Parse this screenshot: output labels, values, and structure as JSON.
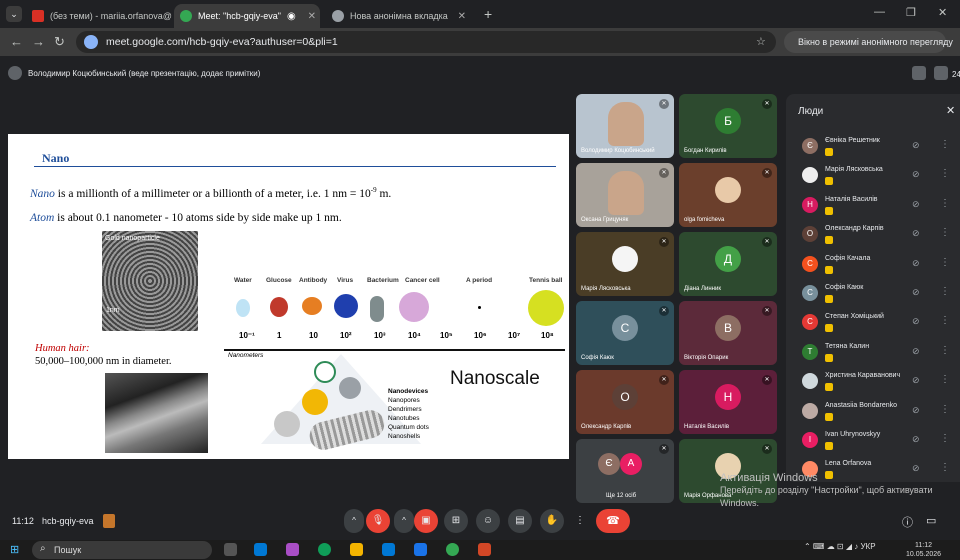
{
  "browser": {
    "tabs": [
      {
        "label": "(без теми) - mariia.orfanova@",
        "favicon_color": "#d93025"
      },
      {
        "label": "Meet: \"hcb-gqiy-eva\"",
        "favicon_color": "#34a853"
      },
      {
        "label": "Нова анонімна вкладка",
        "favicon_color": "#9aa0a6"
      }
    ],
    "url": "meet.google.com/hcb-gqiy-eva?authuser=0&pli=1",
    "incognito_label": "Вікно в режимі анонімного перегляду"
  },
  "meet": {
    "presenter_text": "Володимир Коцюбинський (веде презентацію, додає примітки)",
    "participant_count": "24",
    "time": "11:12",
    "meeting_code": "hcb-gqiy-eva"
  },
  "slide": {
    "title": "Nano",
    "p1_word": "Nano",
    "p1_text": " is a millionth of a millimeter or a billionth of a meter, i.e. 1 nm = 10",
    "p1_exp": "-9",
    "p1_end": " m.",
    "p2_word": "Atom",
    "p2_text": " is  about 0.1 nanometer - 10 atoms side by side make up 1 nm.",
    "gold_label": "Gold nanoparticle",
    "gold_scale": "1nm",
    "hair_label": "Human hair:",
    "hair_text": "50,000–100,000 nm in diameter.",
    "scale_labels": [
      "Water",
      "Glucose",
      "Antibody",
      "Virus",
      "Bacterium",
      "Cancer cell",
      "A period",
      "Tennis ball"
    ],
    "scale_numbers": [
      "10⁻¹",
      "1",
      "10",
      "10²",
      "10³",
      "10⁴",
      "10⁵",
      "10⁶",
      "10⁷",
      "10⁸"
    ],
    "axis_label": "Nanometers",
    "big_label": "Nanoscale",
    "nanodevices_title": "Nanodevices",
    "nanodevices": [
      "Nanopores",
      "Dendrimers",
      "Nanotubes",
      "Quantum dots",
      "Nanoshells"
    ]
  },
  "tiles": [
    {
      "name": "Володимир Коцюбинський",
      "type": "video",
      "bg": "#b8c4cf"
    },
    {
      "name": "Богдан Кирилів",
      "type": "avatar",
      "letter": "Б",
      "bg": "#2d4a2f",
      "av": "#2e7d32"
    },
    {
      "name": "Оксана Грицуняк",
      "type": "video",
      "bg": "#a8a29a"
    },
    {
      "name": "olga fomicheva",
      "type": "avatar",
      "letter": "",
      "bg": "#6b3f2c",
      "av": "#e8c9a8"
    },
    {
      "name": "Марія Лясковська",
      "type": "avatar",
      "letter": "",
      "bg": "#4a3d26",
      "av": "#f5f5f5"
    },
    {
      "name": "Діана Линник",
      "type": "avatar",
      "letter": "Д",
      "bg": "#2d4a2f",
      "av": "#43a047"
    },
    {
      "name": "Софія Каюк",
      "type": "avatar",
      "letter": "С",
      "bg": "#2f4f5a",
      "av": "#78909c"
    },
    {
      "name": "Вікторія Опарик",
      "type": "avatar",
      "letter": "В",
      "bg": "#5c2a3a",
      "av": "#8d6e63"
    },
    {
      "name": "Олександр Карпів",
      "type": "avatar",
      "letter": "О",
      "bg": "#6b3a2c",
      "av": "#5d4037"
    },
    {
      "name": "Наталія Василів",
      "type": "avatar",
      "letter": "Н",
      "bg": "#5c1f3a",
      "av": "#d81b60"
    },
    {
      "name": "Ще 12 осіб",
      "type": "more",
      "letter": "Є",
      "letter2": "А",
      "bg": "#3c4043",
      "av": "#8d6e63",
      "av2": "#e91e63"
    },
    {
      "name": "Марія Орфанова",
      "type": "avatar",
      "letter": "",
      "bg": "#2d4a2f",
      "av": "#e8d2b0"
    }
  ],
  "people": {
    "title": "Люди",
    "list": [
      {
        "name": "Євніка Решетник",
        "letter": "Є",
        "color": "#8d6e63"
      },
      {
        "name": "Марія Лясковська",
        "letter": "",
        "color": "#eeeeee"
      },
      {
        "name": "Наталія Василів",
        "letter": "Н",
        "color": "#d81b60"
      },
      {
        "name": "Олександр Карпів",
        "letter": "О",
        "color": "#5d4037"
      },
      {
        "name": "Софія Качала",
        "letter": "С",
        "color": "#f4511e"
      },
      {
        "name": "Софія Каюк",
        "letter": "С",
        "color": "#78909c"
      },
      {
        "name": "Степан Хоміцький",
        "letter": "С",
        "color": "#e53935"
      },
      {
        "name": "Тетяна Калин",
        "letter": "Т",
        "color": "#2e7d32"
      },
      {
        "name": "Христина Караванович",
        "letter": "",
        "color": "#cfd8dc"
      },
      {
        "name": "Anastasiia Bondarenko",
        "letter": "",
        "color": "#bcaaa4"
      },
      {
        "name": "Ivan Uhrynovskyy",
        "letter": "I",
        "color": "#e91e63"
      },
      {
        "name": "Lena Orfanova",
        "letter": "",
        "color": "#ff8a65"
      }
    ]
  },
  "activation": {
    "title": "Активація Windows",
    "sub": "Перейдіть до розділу \"Настройки\", щоб активувати Windows."
  },
  "taskbar": {
    "search": "Пошук",
    "lang": "УКР",
    "clock_time": "11:12",
    "clock_date": "10.05.2026"
  }
}
